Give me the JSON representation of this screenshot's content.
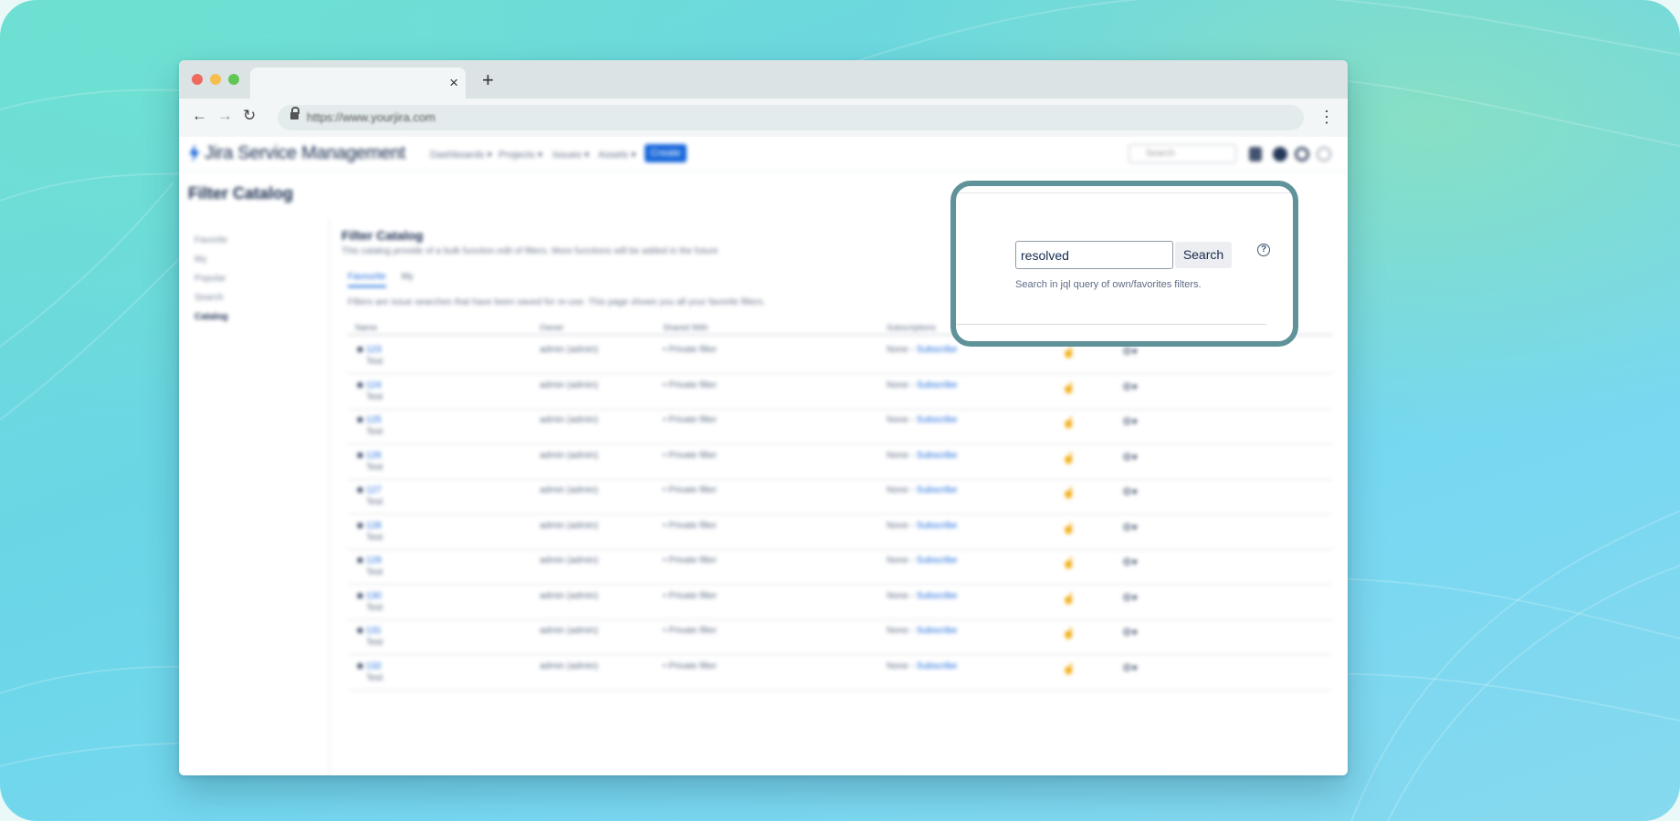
{
  "browser": {
    "url": "https://www.yourjira.com",
    "tab_close": "×",
    "new_tab": "+"
  },
  "app": {
    "logo": "Jira Service Management",
    "menus": [
      "Dashboards ▾",
      "Projects ▾",
      "Issues ▾",
      "Assets ▾"
    ],
    "create_label": "Create",
    "search_placeholder": "Search"
  },
  "page": {
    "header": "Filter Catalog",
    "sidebar": [
      "Favorite",
      "My",
      "Popular",
      "Search",
      "Catalog"
    ],
    "title": "Filter Catalog",
    "description": "This catalog provide of a bulk function edit of filters. More functions will be added in the future",
    "tabs": [
      "Favourite",
      "My"
    ],
    "tab_description": "Filters are issue searches that have been saved for re-use. This page shows you all your favorite filters.",
    "columns": [
      "Name",
      "Owner",
      "Shared With",
      "Subscriptions"
    ],
    "rows": [
      {
        "name": "123",
        "desc": "Test",
        "owner": "admin (admin)",
        "shared": "Private filter",
        "subs": "None",
        "subs_link": "Subscribe"
      },
      {
        "name": "124",
        "desc": "Test",
        "owner": "admin (admin)",
        "shared": "Private filter",
        "subs": "None",
        "subs_link": "Subscribe"
      },
      {
        "name": "125",
        "desc": "Test",
        "owner": "admin (admin)",
        "shared": "Private filter",
        "subs": "None",
        "subs_link": "Subscribe"
      },
      {
        "name": "126",
        "desc": "Test",
        "owner": "admin (admin)",
        "shared": "Private filter",
        "subs": "None",
        "subs_link": "Subscribe"
      },
      {
        "name": "127",
        "desc": "Test",
        "owner": "admin (admin)",
        "shared": "Private filter",
        "subs": "None",
        "subs_link": "Subscribe"
      },
      {
        "name": "128",
        "desc": "Test",
        "owner": "admin (admin)",
        "shared": "Private filter",
        "subs": "None",
        "subs_link": "Subscribe"
      },
      {
        "name": "129",
        "desc": "Test",
        "owner": "admin (admin)",
        "shared": "Private filter",
        "subs": "None",
        "subs_link": "Subscribe"
      },
      {
        "name": "130",
        "desc": "Test",
        "owner": "admin (admin)",
        "shared": "Private filter",
        "subs": "None",
        "subs_link": "Subscribe"
      },
      {
        "name": "131",
        "desc": "Test",
        "owner": "admin (admin)",
        "shared": "Private filter",
        "subs": "None",
        "subs_link": "Subscribe"
      },
      {
        "name": "132",
        "desc": "Test",
        "owner": "admin (admin)",
        "shared": "Private filter",
        "subs": "None",
        "subs_link": "Subscribe"
      }
    ]
  },
  "jql_search": {
    "value": "resolved",
    "button_label": "Search",
    "help_glyph": "?",
    "helper_text": "Search in jql query of own/favorites filters."
  },
  "icons": [
    "back-icon",
    "forward-icon",
    "reload-icon",
    "lock-icon",
    "kebab-menu-icon",
    "star-icon",
    "gear-icon",
    "help-icon"
  ],
  "colors": {
    "highlight_border": "#5f9399",
    "jira_blue": "#1868db",
    "background_teal": "#6fdcd3"
  }
}
